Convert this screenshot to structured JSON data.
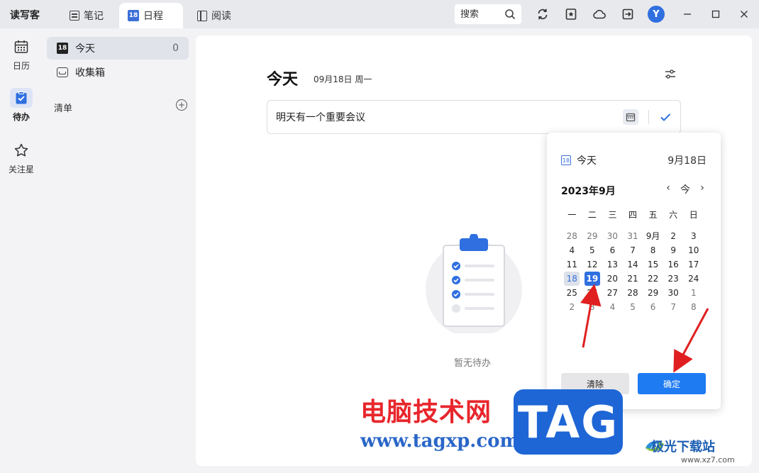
{
  "app": {
    "brand": "读写客"
  },
  "tabs": [
    {
      "label": "笔记"
    },
    {
      "label": "日程",
      "icon_text": "18"
    },
    {
      "label": "阅读"
    }
  ],
  "titlebar": {
    "search_placeholder": "搜索",
    "avatar_letter": "Y"
  },
  "rail": {
    "calendar": "日历",
    "todo": "待办",
    "starred": "关注星"
  },
  "lists": {
    "today_label": "今天",
    "today_icon": "18",
    "today_count": "0",
    "inbox_label": "收集箱",
    "section_title": "清单",
    "add_symbol": "+"
  },
  "main": {
    "title": "今天",
    "date": "09月18日 周一",
    "task_value": "明天有一个重要会议",
    "empty_text": "暂无待办"
  },
  "picker": {
    "today_label": "今天",
    "today_icon": "18",
    "today_date": "9月18日",
    "month_title": "2023年9月",
    "nav_prev": "‹",
    "nav_today": "今",
    "nav_next": "›",
    "weekdays": [
      "一",
      "二",
      "三",
      "四",
      "五",
      "六",
      "日"
    ],
    "weeks": [
      [
        "28",
        "29",
        "30",
        "31",
        "9月",
        "2",
        "3"
      ],
      [
        "4",
        "5",
        "6",
        "7",
        "8",
        "9",
        "10"
      ],
      [
        "11",
        "12",
        "13",
        "14",
        "15",
        "16",
        "17"
      ],
      [
        "18",
        "19",
        "20",
        "21",
        "22",
        "23",
        "24"
      ],
      [
        "25",
        "26",
        "27",
        "28",
        "29",
        "30",
        "1"
      ],
      [
        "2",
        "3",
        "4",
        "5",
        "6",
        "7",
        "8"
      ]
    ],
    "today_day": "18",
    "selected_day": "19",
    "clear_label": "清除",
    "ok_label": "确定"
  },
  "watermark": {
    "site_cn": "电脑技术网",
    "site_url": "www.tagxp.com",
    "tag": "TAG",
    "jg_name": "极光下载站",
    "jg_url": "www.xz7.com"
  },
  "colors": {
    "accent": "#2f6fe0",
    "ok_button": "#1f7bf2",
    "watermark_red": "#e8262c",
    "arrow_red": "#e02020"
  }
}
